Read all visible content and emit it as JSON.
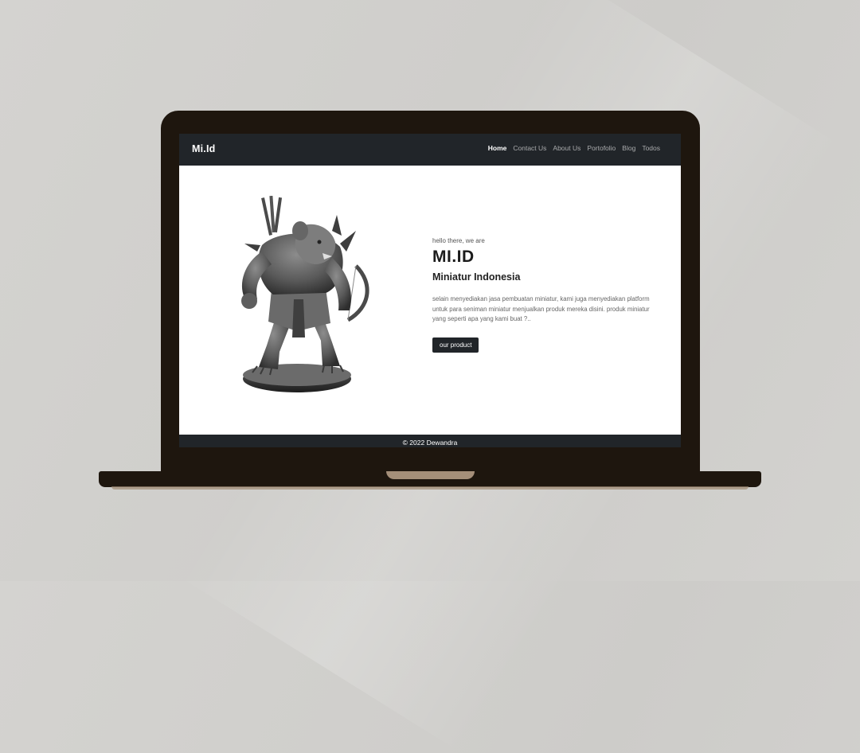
{
  "nav": {
    "brand": "Mi.Id",
    "links": [
      "Home",
      "Contact Us",
      "About Us",
      "Portofolio",
      "Blog",
      "Todos"
    ]
  },
  "hero": {
    "greeting": "hello there, we are",
    "title": "MI.ID",
    "subtitle": "Miniatur Indonesia",
    "description": "selain menyediakan jasa pembuatan miniatur, kami juga menyediakan platform untuk para seniman miniatur menjualkan produk mereka disini. produk miniatur yang seperti apa yang kami buat ?..",
    "button_label": "our product"
  },
  "footer": {
    "text": "© 2022 Dewandra"
  },
  "colors": {
    "navbar": "#212529",
    "laptop_body": "#1e160e",
    "background": "#d1d0cd"
  },
  "icons": {
    "hero_image": "rat-warrior-miniature"
  }
}
